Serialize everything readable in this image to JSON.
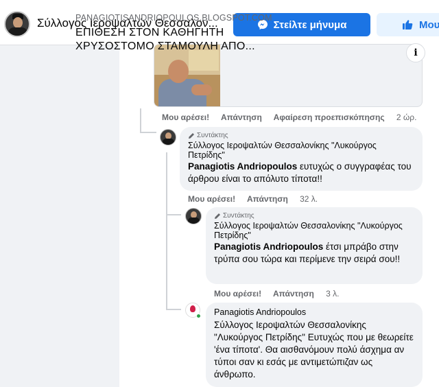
{
  "header": {
    "page_name": "Σύλλογος Ιεροψαλτών Θεσσαλον...",
    "message_button": "Στείλτε μήνυμα",
    "like_button": "Μου"
  },
  "link_preview": {
    "domain": "PANAGIOTISANDRIOPOULOS.BLOGSPOT.COM",
    "title": "ΕΠΙΘΕΣΗ ΣΤΟΝ ΚΑΘΗΓΗΤΗ ΧΡΥΣΟΣΤΟΜΟ ΣΤΑΜΟΥΛΗ ΑΠΟ...",
    "info_icon": "i"
  },
  "post_actions": {
    "like": "Μου αρέσει!",
    "reply": "Απάντηση",
    "remove_preview": "Αφαίρεση προεπισκόπησης",
    "time": "2 ώρ."
  },
  "comments": [
    {
      "role": "Συντάκτης",
      "author": "Σύλλογος Ιεροψαλτών Θεσσαλονίκης \"Λυκούργος Πετρίδης\"",
      "mention": "Panagiotis Andriopoulos",
      "text": " ευτυχώς ο συγγραφέας του άρθρου είναι το απόλυτο τίποτα!!",
      "like": "Μου αρέσει!",
      "reply": "Απάντηση",
      "time": "32 λ."
    },
    {
      "role": "Συντάκτης",
      "author": "Σύλλογος Ιεροψαλτών Θεσσαλονίκης \"Λυκούργος Πετρίδης\"",
      "mention": "Panagiotis Andriopoulos",
      "text": " έτσι μπράβο στην τρύπα σου τώρα και περίμενε την σειρά σου!!",
      "like": "Μου αρέσει!",
      "reply": "Απάντηση",
      "time": "3 λ."
    },
    {
      "author": "Panagiotis Andriopoulos",
      "mention": "Σύλλογος Ιεροψαλτών Θεσσαλονίκης \"Λυκούργος Πετρίδης\"",
      "text": " Ευτυχώς που με θεωρείτε 'ένα τίποτα'. Θα αισθανόμουν πολύ άσχημα αν τύποι σαν κι εσάς με αντιμετώπιζαν ως άνθρωπο."
    }
  ],
  "icons": {
    "messenger": "messenger-icon",
    "thumbs_up": "thumbs-up-icon",
    "pencil": "pencil-icon"
  },
  "colors": {
    "primary": "#1b74e4",
    "bubble": "#f0f2f5",
    "muted_text": "#65676b"
  }
}
